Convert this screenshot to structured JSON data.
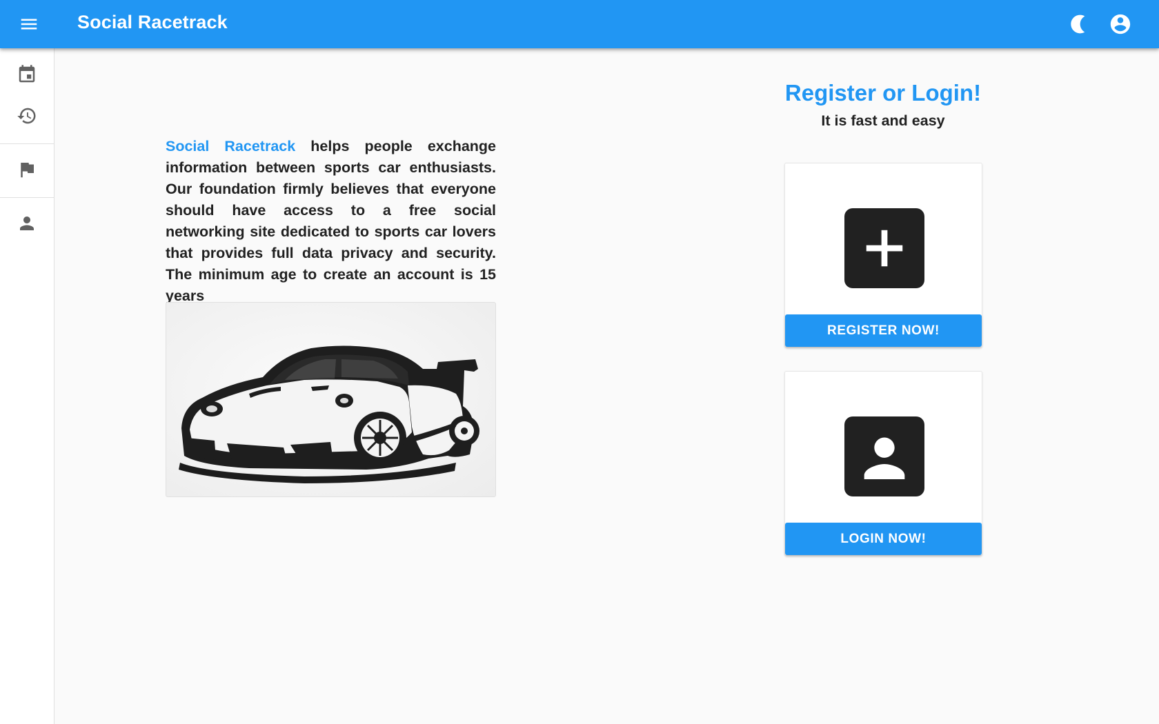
{
  "app_bar": {
    "title": "Social Racetrack",
    "menu_icon": "menu-icon",
    "theme_icon": "dark-mode-icon",
    "account_icon": "account-circle-icon",
    "color": "#2196f3"
  },
  "nav_rail": {
    "items": [
      {
        "icon": "calendar-icon"
      },
      {
        "icon": "history-icon"
      },
      {
        "icon": "flag-icon"
      },
      {
        "icon": "person-icon"
      }
    ]
  },
  "intro": {
    "brand": "Social Racetrack",
    "text": " helps people exchange information between sports car enthusiasts. Our foundation firmly believes that everyone should have access to a free social networking site dedicated to sports car lovers that provides full data privacy and security. The minimum age to create an account is 15 years"
  },
  "auth": {
    "heading": "Register or Login!",
    "subheading": "It is fast and easy",
    "register": {
      "icon": "add-box-icon",
      "button_label": "REGISTER NOW!"
    },
    "login": {
      "icon": "account-box-icon",
      "button_label": "LOGIN NOW!"
    }
  }
}
